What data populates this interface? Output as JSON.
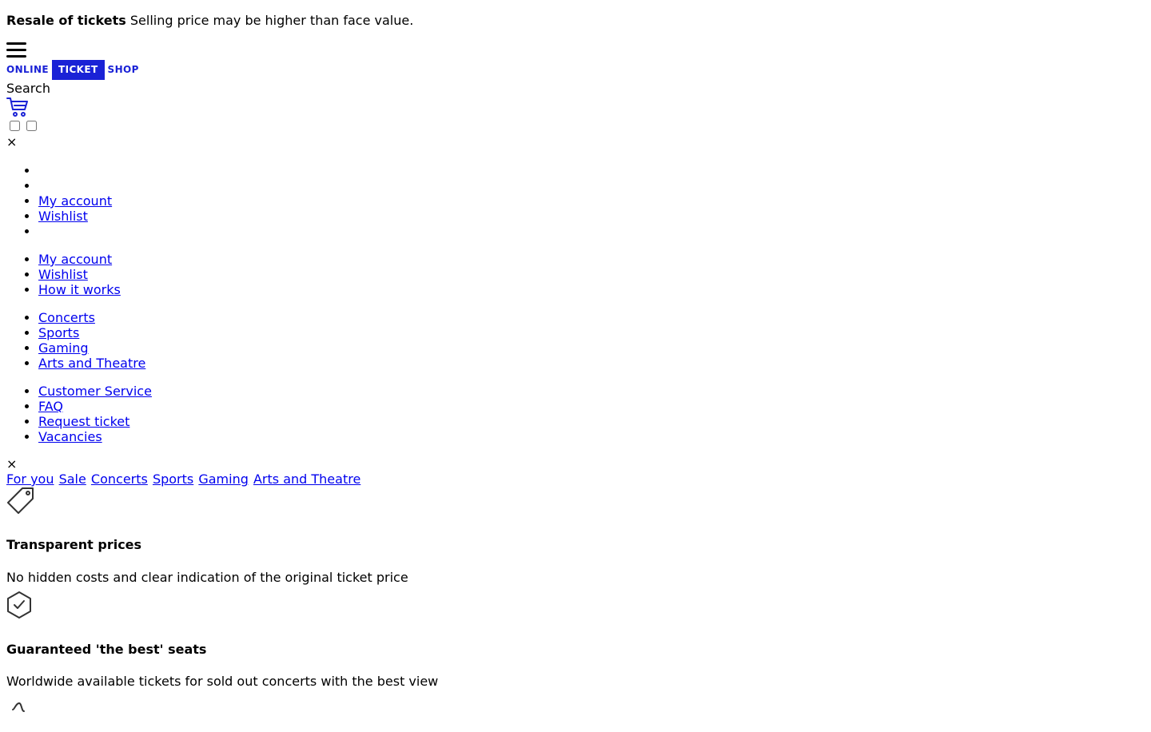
{
  "announcement": {
    "title": "Resale of tickets",
    "text": "Selling price may be higher than face value."
  },
  "icons": {
    "menu": "hamburger-icon",
    "cart": "cart-icon",
    "close": "close-icon",
    "tag": "tag-icon",
    "shield": "shield-check-icon"
  },
  "logo": {
    "left": "ONLINE",
    "middle": "TICKET",
    "right": "SHOP",
    "color": "#1a22d6"
  },
  "search": {
    "label": "Search"
  },
  "close_label": "×",
  "menu_top": {
    "items": [
      "",
      "",
      "My account",
      "Wishlist",
      ""
    ]
  },
  "menu_account": {
    "items": [
      "My account",
      "Wishlist",
      "How it works"
    ]
  },
  "menu_categories": {
    "items": [
      "Concerts",
      "Sports",
      "Gaming",
      "Arts and Theatre"
    ]
  },
  "menu_service": {
    "items": [
      "Customer Service",
      "FAQ",
      "Request ticket",
      "Vacancies"
    ]
  },
  "tabs": [
    "For you",
    "Sale",
    "Concerts",
    "Sports",
    "Gaming",
    "Arts and Theatre"
  ],
  "features": [
    {
      "title": "Transparent prices",
      "text": "No hidden costs and clear indication of the original ticket price"
    },
    {
      "title": "Guaranteed 'the best' seats",
      "text": "Worldwide available tickets for sold out concerts with the best view"
    }
  ]
}
